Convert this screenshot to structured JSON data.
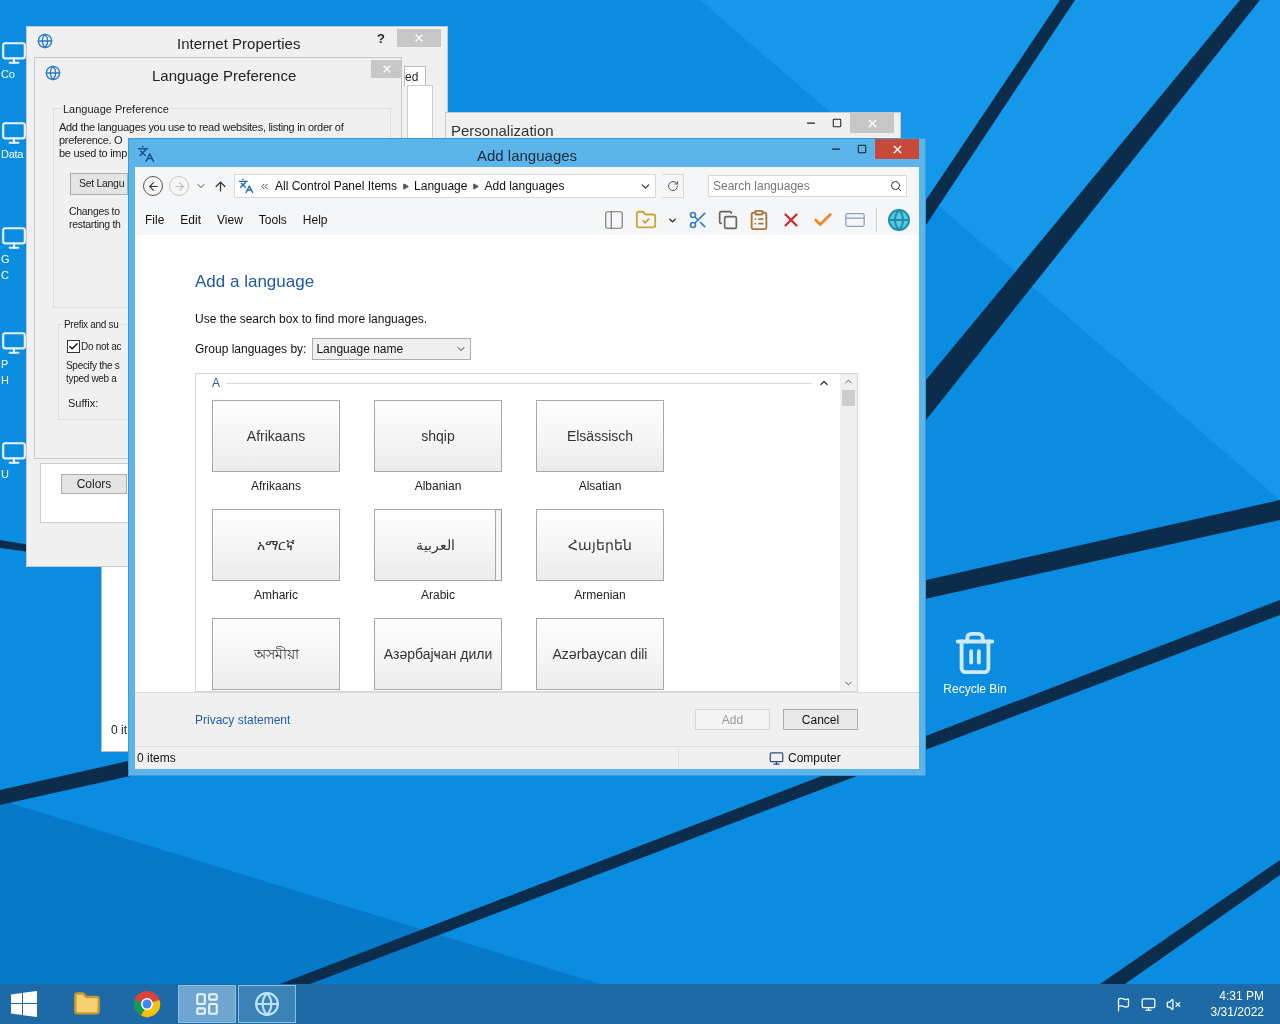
{
  "desktop_icons": [
    {
      "lines": [
        "Co"
      ]
    },
    {
      "lines": [
        "Data"
      ]
    },
    {
      "lines": [
        "G",
        "C"
      ]
    },
    {
      "lines": [
        "P",
        "H"
      ]
    },
    {
      "lines": [
        "U"
      ]
    }
  ],
  "recycle_bin": {
    "label": "Recycle Bin"
  },
  "background_window": {
    "status_text": "0 it"
  },
  "internet_properties": {
    "title": "Internet Properties",
    "help": "?",
    "tab_fragment": "ed",
    "colors_button": "Colors"
  },
  "language_preference": {
    "title": "Language Preference",
    "group_title": "Language Preference",
    "description": [
      "Add the languages you use to read websites, listing in order of",
      "preference. O",
      "be used to imp"
    ],
    "set_button": "Set Langu",
    "changes_note": [
      "Changes to",
      "restarting th"
    ],
    "prefix_group": {
      "title": "Prefix and su",
      "checkbox": {
        "label": "Do not ac",
        "checked": true
      },
      "note": [
        "Specify the s",
        "typed web a"
      ],
      "suffix_label": "Suffix:"
    }
  },
  "personalization": {
    "title": "Personalization"
  },
  "add_languages": {
    "title": "Add languages",
    "address": {
      "path": [
        "All Control Panel Items",
        "Language",
        "Add languages"
      ]
    },
    "search": {
      "placeholder": "Search languages"
    },
    "menu": [
      "File",
      "Edit",
      "View",
      "Tools",
      "Help"
    ],
    "heading": "Add a language",
    "hint": "Use the search box to find more languages.",
    "group_by": {
      "label": "Group languages by:",
      "value": "Language name"
    },
    "group_letter": "A",
    "languages": [
      {
        "native": "Afrikaans",
        "name": "Afrikaans",
        "stacked": false
      },
      {
        "native": "shqip",
        "name": "Albanian",
        "stacked": false
      },
      {
        "native": "Elsässisch",
        "name": "Alsatian",
        "stacked": false
      },
      {
        "native": "አማርኛ",
        "name": "Amharic",
        "stacked": false
      },
      {
        "native": "العربية",
        "name": "Arabic",
        "stacked": true
      },
      {
        "native": "Հայերեն",
        "name": "Armenian",
        "stacked": false
      },
      {
        "native": "অসমীয়া",
        "stacked": false
      },
      {
        "native": "Азәрбајҹан дили",
        "stacked": false
      },
      {
        "native": "Azərbaycan dili",
        "stacked": false
      }
    ],
    "privacy_link": "Privacy statement",
    "buttons": [
      {
        "label": "Add",
        "disabled": true
      },
      {
        "label": "Cancel",
        "disabled": false
      }
    ],
    "status": {
      "items": "0 items",
      "zone": "Computer"
    }
  },
  "taskbar": {
    "apps": [
      {
        "kind": "folder",
        "open": false,
        "selected": false
      },
      {
        "kind": "browser",
        "open": false,
        "selected": false
      },
      {
        "kind": "control-panel",
        "open": true,
        "selected": true
      },
      {
        "kind": "internet-options",
        "open": true,
        "selected": false
      }
    ],
    "clock": {
      "time": "4:31 PM",
      "date": "3/31/2022"
    }
  }
}
